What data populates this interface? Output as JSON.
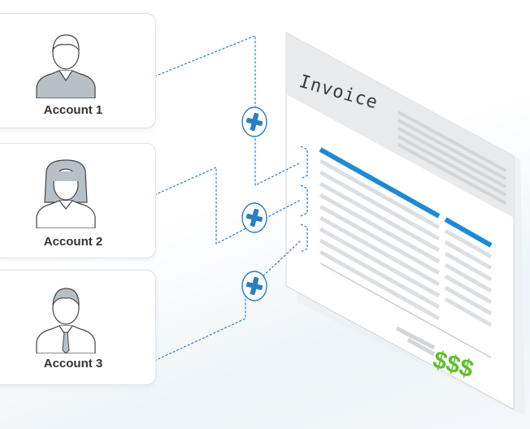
{
  "accounts": [
    {
      "label": "Account 1",
      "avatar": "male-user-icon"
    },
    {
      "label": "Account 2",
      "avatar": "female-user-icon"
    },
    {
      "label": "Account 3",
      "avatar": "male-tie-user-icon"
    }
  ],
  "invoice": {
    "title": "Invoice",
    "total_symbol": "$$$"
  },
  "colors": {
    "accent_blue": "#1f8ad4",
    "money_green": "#5cbf2a",
    "line_gray": "#d9dcdf"
  },
  "connectors": [
    "plus-icon",
    "plus-icon",
    "plus-icon"
  ]
}
